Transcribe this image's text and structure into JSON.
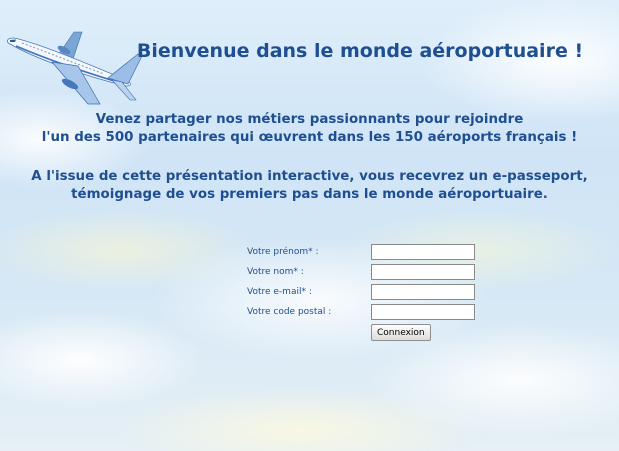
{
  "header": {
    "title": "Bienvenue dans le monde aéroportuaire !"
  },
  "intro": {
    "line1": "Venez partager nos métiers passionnants pour rejoindre",
    "line2": "l'un des 500 partenaires qui œuvrent dans les 150 aéroports français !",
    "line3": "A l'issue de cette présentation interactive, vous recevrez un e-passeport,",
    "line4": "témoignage de vos premiers pas dans le monde aéroportuaire."
  },
  "form": {
    "firstname_label": "Votre prénom* :",
    "firstname_value": "",
    "lastname_label": "Votre nom* :",
    "lastname_value": "",
    "email_label": "Votre e-mail* :",
    "email_value": "",
    "postal_label": "Votre code postal :",
    "postal_value": "",
    "submit_label": "Connexion"
  },
  "icons": {
    "logo": "airplane-icon"
  },
  "colors": {
    "text": "#1f4f91",
    "sky": "#cfe4f6"
  }
}
